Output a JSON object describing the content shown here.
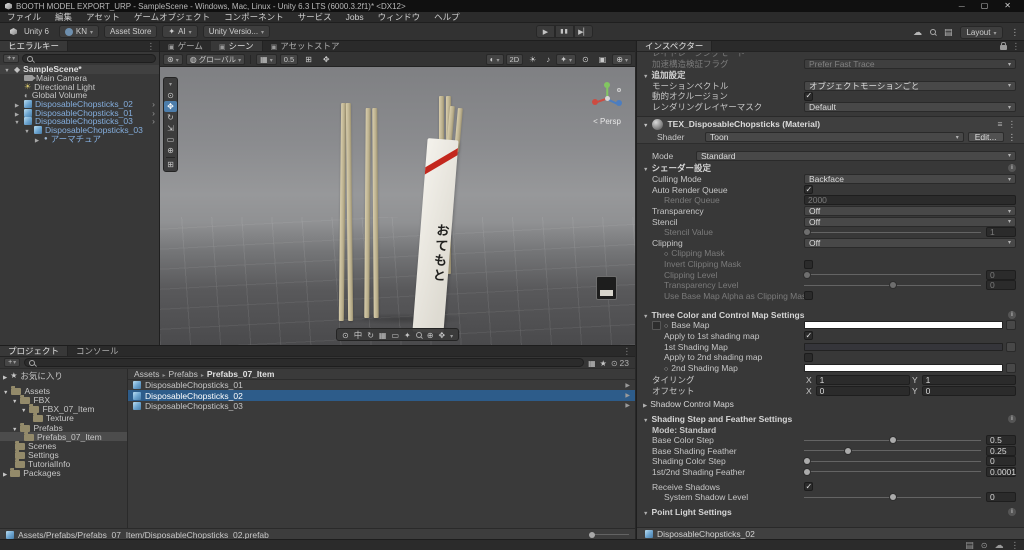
{
  "titlebar": {
    "title": "BOOTH MODEL EXPORT_URP - SampleScene - Windows, Mac, Linux - Unity 6.3 LTS (6000.3.2f1)* <DX12>"
  },
  "menubar": {
    "items": [
      "ファイル",
      "編集",
      "アセット",
      "ゲームオブジェクト",
      "コンポーネント",
      "サービス",
      "Jobs",
      "ウィンドウ",
      "ヘルプ"
    ]
  },
  "toolbar": {
    "unity_version": "Unity 6",
    "account": "KN",
    "asset_store": "Asset Store",
    "ai": "AI",
    "version_control": "Unity Versio...",
    "layout": "Layout"
  },
  "hierarchy": {
    "tab": "ヒエラルキー",
    "items": {
      "scene": "SampleScene*",
      "camera": "Main Camera",
      "light": "Directional Light",
      "volume": "Global Volume",
      "c02": "DisposableChopsticks_02",
      "c01": "DisposableChopsticks_01",
      "c03": "DisposableChopsticks_03",
      "c03_child": "DisposableChopsticks_03",
      "armature": "アーマチュア"
    }
  },
  "center_tabs": {
    "game": "ゲーム",
    "scene": "シーン",
    "store": "アセットストア"
  },
  "scene": {
    "space": "グローバル",
    "snap": "0.5",
    "two_d": "2D",
    "overlay_label": "中",
    "persp": "< Persp",
    "sleeve_text": "おてもと"
  },
  "inspector": {
    "tab": "インスペクター",
    "raytrace": {
      "label": "レイトレーシングモード"
    },
    "accel": {
      "label": "加速構造検証フラグ",
      "value": "Prefer Fast Trace"
    },
    "additional": {
      "header": "追加設定",
      "motion": {
        "label": "モーションベクトル",
        "value": "オブジェクトモーションごと"
      },
      "occlusion": {
        "label": "動的オクルージョン"
      },
      "layer_mask": {
        "label": "レンダリングレイヤーマスク",
        "value": "Default"
      }
    },
    "material": {
      "name": "TEX_DisposableChopsticks (Material)",
      "shader_label": "Shader",
      "shader_value": "Toon",
      "edit_button": "Edit...",
      "mode_label": "Mode",
      "mode_value": "Standard"
    },
    "shader_settings": {
      "header": "シェーダー設定",
      "culling": {
        "label": "Culling Mode",
        "value": "Backface"
      },
      "auto_queue": {
        "label": "Auto Render Queue"
      },
      "render_queue": {
        "label": "Render Queue",
        "value": "2000"
      },
      "transparency": {
        "label": "Transparency",
        "value": "Off"
      },
      "stencil": {
        "label": "Stencil",
        "value": "Off"
      },
      "stencil_value": {
        "label": "Stencil Value",
        "value": "1"
      },
      "clipping": {
        "label": "Clipping",
        "value": "Off"
      },
      "clipping_mask": {
        "label": "Clipping Mask"
      },
      "invert_clipping": {
        "label": "Invert Clipping Mask"
      },
      "clipping_level": {
        "label": "Clipping Level",
        "value": "0"
      },
      "transparency_level": {
        "label": "Transparency Level",
        "value": "0"
      },
      "use_base_alpha": {
        "label": "Use Base Map Alpha as Clipping Mask"
      }
    },
    "three_color": {
      "header": "Three Color and Control Map Settings",
      "base_map": {
        "label": "Base Map",
        "color": "#ffffff"
      },
      "apply_1st": {
        "label": "Apply to 1st shading map"
      },
      "first_map": {
        "label": "1st Shading Map",
        "color": "#35353a"
      },
      "apply_2nd": {
        "label": "Apply to 2nd shading map"
      },
      "second_map": {
        "label": "2nd Shading Map",
        "color": "#ffffff"
      },
      "tiling": {
        "label": "タイリング",
        "x_label": "X",
        "x": "1",
        "y_label": "Y",
        "y": "1"
      },
      "offset": {
        "label": "オフセット",
        "x_label": "X",
        "x": "0",
        "y_label": "Y",
        "y": "0"
      },
      "shadow_maps": {
        "label": "Shadow Control Maps"
      }
    },
    "shading": {
      "header": "Shading Step and Feather Settings",
      "mode_line": "Mode: Standard",
      "base_step": {
        "label": "Base Color Step",
        "value": "0.5"
      },
      "base_feather": {
        "label": "Base Shading Feather",
        "value": "0.25"
      },
      "color_step": {
        "label": "Shading Color Step",
        "value": "0"
      },
      "sf_feather": {
        "label": "1st/2nd Shading Feather",
        "value": "0.0001"
      },
      "receive": {
        "label": "Receive Shadows"
      },
      "system_level": {
        "label": "System Shadow Level",
        "value": "0"
      }
    },
    "point_light": {
      "header": "Point Light Settings"
    },
    "footer": "DisposableChopsticks_02"
  },
  "project": {
    "tab_project": "プロジェクト",
    "tab_console": "コンソール",
    "hidden_count": "23",
    "favorites": "お気に入り",
    "tree": {
      "assets": "Assets",
      "fbx": "FBX",
      "fbx_item": "FBX_07_Item",
      "texture": "Texture",
      "prefabs": "Prefabs",
      "prefabs_item": "Prefabs_07_Item",
      "scenes": "Scenes",
      "settings": "Settings",
      "tutorial": "TutorialInfo",
      "packages": "Packages"
    },
    "breadcrumb": {
      "a": "Assets",
      "b": "Prefabs",
      "c": "Prefabs_07_Item"
    },
    "files": {
      "f1": "DisposableChopsticks_01",
      "f2": "DisposableChopsticks_02",
      "f3": "DisposableChopsticks_03"
    },
    "footer_path": "Assets/Prefabs/Prefabs_07_Item/DisposableChopsticks_02.prefab"
  }
}
